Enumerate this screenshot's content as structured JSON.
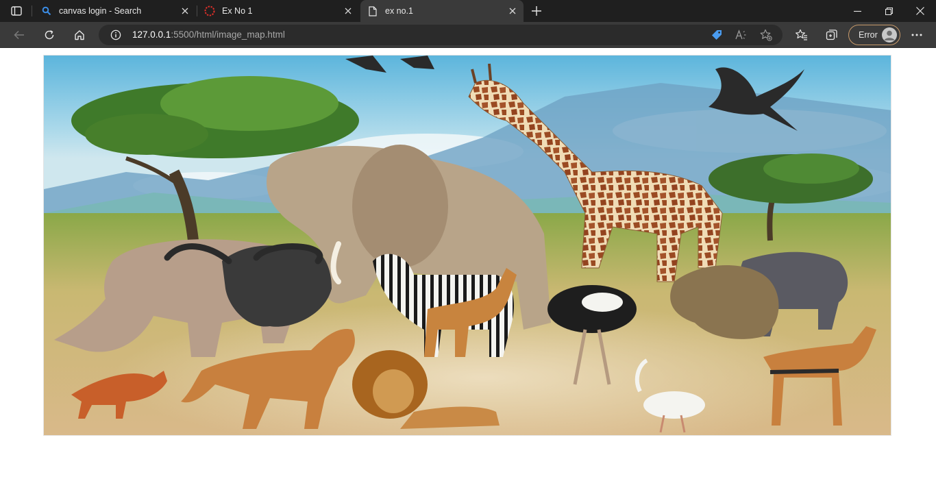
{
  "tabs": [
    {
      "title": "canvas login - Search",
      "icon": "search-icon"
    },
    {
      "title": "Ex No 1",
      "icon": "spinner-icon"
    },
    {
      "title": "ex no.1",
      "icon": "page-icon"
    }
  ],
  "address": {
    "host": "127.0.0.1",
    "path": ":5500/html/image_map.html"
  },
  "profile": {
    "status_label": "Error"
  },
  "colors": {
    "accent_error": "#c79a6a",
    "chrome_dark": "#1f1f1f",
    "toolbar": "#3a3a3a"
  },
  "image": {
    "description_name": "african-wildlife-collage"
  }
}
